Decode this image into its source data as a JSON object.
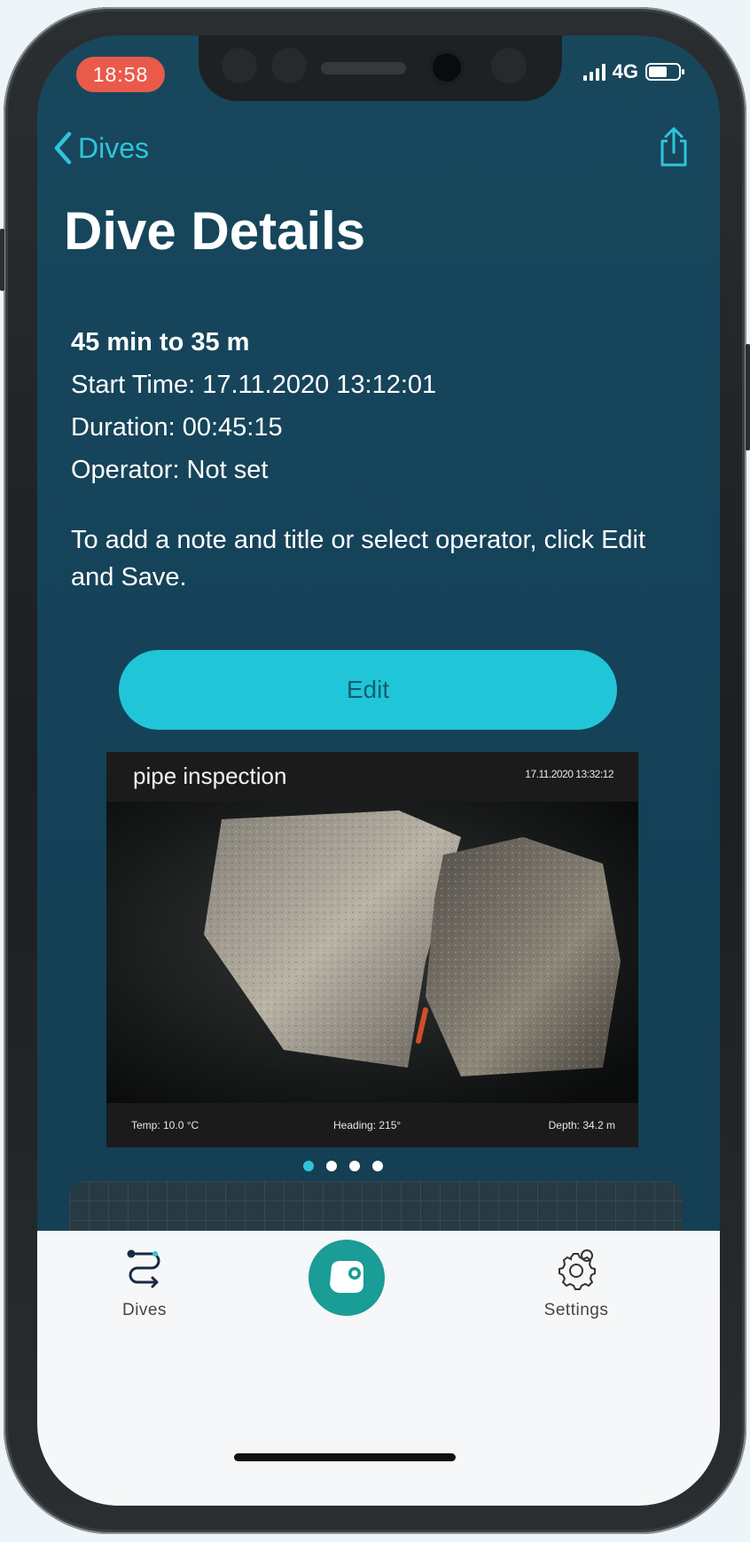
{
  "status_bar": {
    "time": "18:58",
    "network": "4G"
  },
  "nav": {
    "back_label": "Dives",
    "title": "Dive Details"
  },
  "dive": {
    "headline": "45 min to 35 m",
    "start_time": "Start Time: 17.11.2020 13:12:01",
    "duration": "Duration: 00:45:15",
    "operator": "Operator: Not set"
  },
  "note": "To add a note and title or select operator, click Edit and Save.",
  "edit_label": "Edit",
  "media": {
    "title": "pipe inspection",
    "timestamp": "17.11.2020 13:32:12",
    "temp": "Temp: 10.0 °C",
    "heading": "Heading: 215°",
    "depth": "Depth: 34.2 m"
  },
  "carousel": {
    "count": 4,
    "active_index": 0
  },
  "tabbar": {
    "dives_label": "Dives",
    "settings_label": "Settings"
  },
  "colors": {
    "accent": "#21c5d8",
    "background": "#15435a",
    "center_button": "#1a9c97",
    "time_pill": "#e95a4b"
  }
}
